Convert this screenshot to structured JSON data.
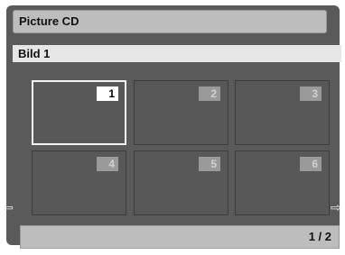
{
  "header": {
    "title": "Picture CD"
  },
  "subtitle": {
    "label": "Bild 1"
  },
  "thumbnails": [
    {
      "number": "1",
      "selected": true
    },
    {
      "number": "2",
      "selected": false
    },
    {
      "number": "3",
      "selected": false
    },
    {
      "number": "4",
      "selected": false
    },
    {
      "number": "5",
      "selected": false
    },
    {
      "number": "6",
      "selected": false
    }
  ],
  "navigation": {
    "prev_icon": "left-arrow-icon",
    "next_icon": "right-arrow-icon"
  },
  "footer": {
    "page": "1 / 2"
  }
}
